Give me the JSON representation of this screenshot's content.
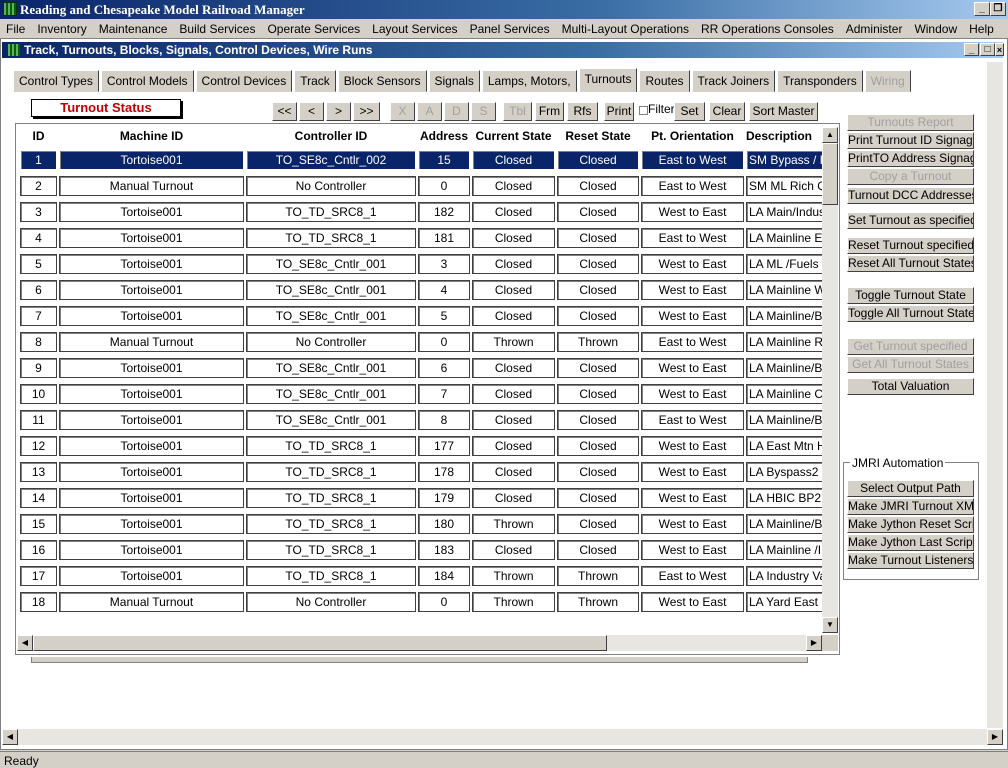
{
  "app": {
    "title": "Reading and Chesapeake Model Railroad Manager"
  },
  "menu": [
    "File",
    "Inventory",
    "Maintenance",
    "Build Services",
    "Operate Services",
    "Layout Services",
    "Panel Services",
    "Multi-Layout Operations",
    "RR Operations Consoles",
    "Administer",
    "Window",
    "Help"
  ],
  "child_window": {
    "title": "Track, Turnouts, Blocks, Signals, Control Devices, Wire Runs"
  },
  "tabs": [
    {
      "label": "Control Types",
      "state": "normal"
    },
    {
      "label": "Control Models",
      "state": "normal"
    },
    {
      "label": "Control Devices",
      "state": "normal"
    },
    {
      "label": "Track",
      "state": "normal"
    },
    {
      "label": "Block Sensors",
      "state": "normal"
    },
    {
      "label": "Signals",
      "state": "normal"
    },
    {
      "label": "Lamps, Motors,",
      "state": "normal"
    },
    {
      "label": "Turnouts",
      "state": "active"
    },
    {
      "label": "Routes",
      "state": "normal"
    },
    {
      "label": "Track Joiners",
      "state": "normal"
    },
    {
      "label": "Transponders",
      "state": "normal"
    },
    {
      "label": "Wiring",
      "state": "disabled"
    }
  ],
  "panel_title": "Turnout Status",
  "nav_buttons": {
    "first": "<<",
    "prev": "<",
    "next": ">",
    "last": ">>",
    "delete": "X",
    "add": "A",
    "d": "D",
    "s": "S",
    "tbl": "Tbl",
    "frm": "Frm",
    "rfs": "Rfs",
    "print": "Print",
    "filter": "Filter",
    "set": "Set",
    "clear": "Clear",
    "sort_master": "Sort Master"
  },
  "table": {
    "columns": [
      "ID",
      "Machine ID",
      "Controller ID",
      "Address",
      "Current State",
      "Reset State",
      "Pt. Orientation",
      "Description"
    ],
    "rows": [
      [
        "1",
        "Tortoise001",
        "TO_SE8c_Cntlr_002",
        "15",
        "Closed",
        "Closed",
        "East to West",
        "SM Bypass / F"
      ],
      [
        "2",
        "Manual Turnout",
        "No Controller",
        "0",
        "Closed",
        "Closed",
        "East to West",
        "SM ML Rich Q"
      ],
      [
        "3",
        "Tortoise001",
        "TO_TD_SRC8_1",
        "182",
        "Closed",
        "Closed",
        "West to East",
        "LA Main/Indus"
      ],
      [
        "4",
        "Tortoise001",
        "TO_TD_SRC8_1",
        "181",
        "Closed",
        "Closed",
        "East to West",
        "LA Mainline E"
      ],
      [
        "5",
        "Tortoise001",
        "TO_SE8c_Cntlr_001",
        "3",
        "Closed",
        "Closed",
        "West to East",
        "LA ML /Fuels I"
      ],
      [
        "6",
        "Tortoise001",
        "TO_SE8c_Cntlr_001",
        "4",
        "Closed",
        "Closed",
        "West to East",
        "LA Mainline W"
      ],
      [
        "7",
        "Tortoise001",
        "TO_SE8c_Cntlr_001",
        "5",
        "Closed",
        "Closed",
        "West to East",
        "LA Mainline/B'"
      ],
      [
        "8",
        "Manual Turnout",
        "No Controller",
        "0",
        "Thrown",
        "Thrown",
        "East to West",
        "LA Mainline R"
      ],
      [
        "9",
        "Tortoise001",
        "TO_SE8c_Cntlr_001",
        "6",
        "Closed",
        "Closed",
        "West to East",
        "LA Mainline/B'"
      ],
      [
        "10",
        "Tortoise001",
        "TO_SE8c_Cntlr_001",
        "7",
        "Closed",
        "Closed",
        "West to East",
        "LA Mainline C"
      ],
      [
        "11",
        "Tortoise001",
        "TO_SE8c_Cntlr_001",
        "8",
        "Closed",
        "Closed",
        "East to West",
        "LA Mainline/B'"
      ],
      [
        "12",
        "Tortoise001",
        "TO_TD_SRC8_1",
        "177",
        "Closed",
        "Closed",
        "West to East",
        "LA East Mtn H"
      ],
      [
        "13",
        "Tortoise001",
        "TO_TD_SRC8_1",
        "178",
        "Closed",
        "Closed",
        "West to East",
        "LA Byspass2"
      ],
      [
        "14",
        "Tortoise001",
        "TO_TD_SRC8_1",
        "179",
        "Closed",
        "Closed",
        "West to East",
        "LA HBIC BP2:"
      ],
      [
        "15",
        "Tortoise001",
        "TO_TD_SRC8_1",
        "180",
        "Thrown",
        "Closed",
        "West to East",
        "LA Mainline/B'"
      ],
      [
        "16",
        "Tortoise001",
        "TO_TD_SRC8_1",
        "183",
        "Closed",
        "Closed",
        "West to East",
        "LA Mainline /I"
      ],
      [
        "17",
        "Tortoise001",
        "TO_TD_SRC8_1",
        "184",
        "Thrown",
        "Thrown",
        "East to West",
        "LA Industry Va"
      ],
      [
        "18",
        "Manual Turnout",
        "No Controller",
        "0",
        "Thrown",
        "Thrown",
        "West to East",
        "LA Yard East I"
      ]
    ],
    "selected_row": 0
  },
  "right_buttons": [
    {
      "label": "Turnouts Report",
      "enabled": false
    },
    {
      "label": "Print Turnout ID Signage",
      "enabled": true
    },
    {
      "label": "PrintTO Address Signage",
      "enabled": true
    },
    {
      "label": "Copy a Turnout",
      "enabled": false
    },
    {
      "label": "Turnout DCC Addresses",
      "enabled": true
    },
    {
      "label": "Set Turnout as specified",
      "enabled": true
    },
    {
      "label": "Reset Turnout specified",
      "enabled": true
    },
    {
      "label": "Reset All Turnout States",
      "enabled": true
    },
    {
      "label": "Toggle Turnout State",
      "enabled": true
    },
    {
      "label": "Toggle All Turnout States",
      "enabled": true
    },
    {
      "label": "Get Turnout specified",
      "enabled": false
    },
    {
      "label": "Get All Turnout States",
      "enabled": false
    },
    {
      "label": "Total Valuation",
      "enabled": true
    }
  ],
  "jmri": {
    "legend": "JMRI Automation",
    "buttons": [
      "Select Output Path",
      "Make JMRI Turnout XML",
      "Make Jython Reset Script",
      "Make Jython Last Script",
      "Make Turnout Listeners"
    ]
  },
  "status": "Ready",
  "colors": {
    "title_bar": "#0a246a",
    "selection": "#0a246a",
    "status_label_text": "#c00000"
  }
}
